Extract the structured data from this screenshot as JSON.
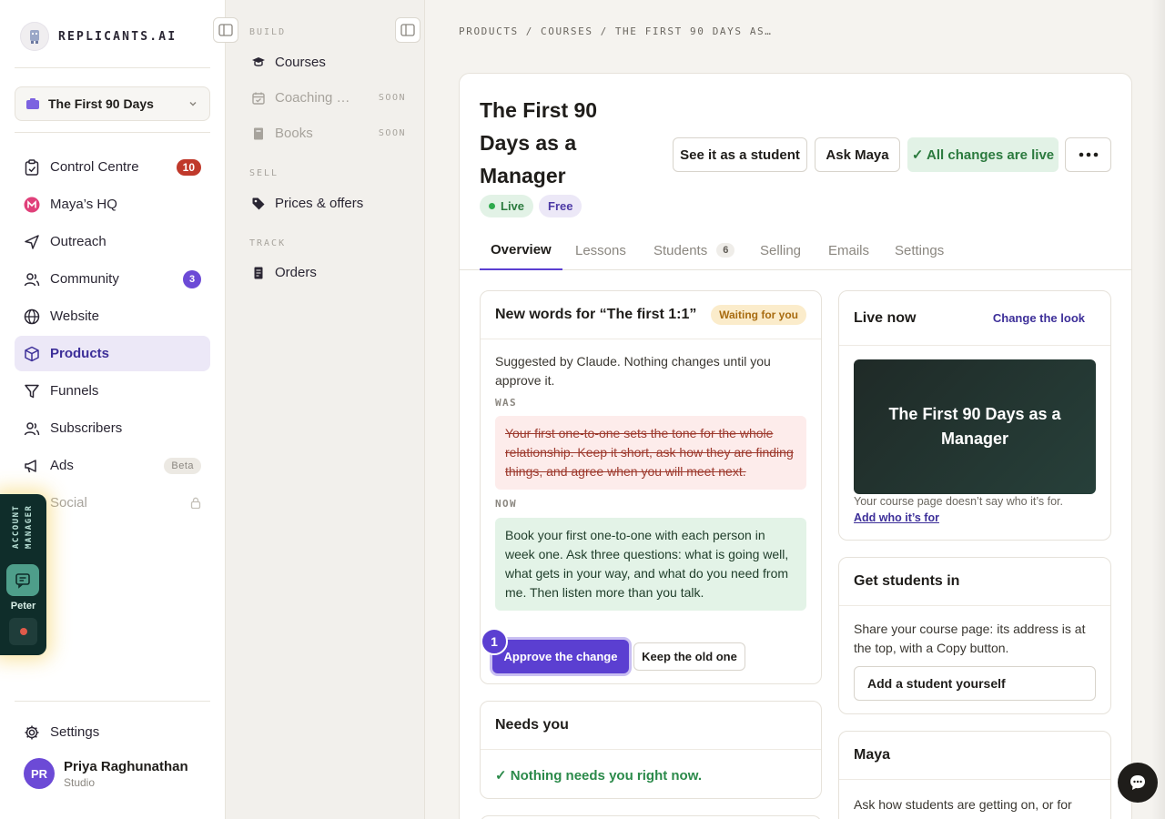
{
  "brand": {
    "name": "REPLICANTS.AI"
  },
  "project": {
    "name": "The First 90 Days"
  },
  "nav": {
    "items": [
      {
        "label": "Control Centre",
        "badge": "10"
      },
      {
        "label": "Maya’s HQ"
      },
      {
        "label": "Outreach"
      },
      {
        "label": "Community",
        "badge": "3"
      },
      {
        "label": "Website"
      },
      {
        "label": "Products"
      },
      {
        "label": "Funnels"
      },
      {
        "label": "Subscribers"
      },
      {
        "label": "Ads",
        "badge": "Beta"
      },
      {
        "label": "Social"
      }
    ],
    "settings": "Settings"
  },
  "user": {
    "initials": "PR",
    "name": "Priya Raghunathan",
    "role": "Studio"
  },
  "account_manager": {
    "label": "ACCOUNT MANAGER",
    "name": "Peter"
  },
  "subnav": {
    "build_head": "BUILD",
    "courses": "Courses",
    "coaching": "Coaching …",
    "coaching_soon": "SOON",
    "books": "Books",
    "books_soon": "SOON",
    "sell_head": "SELL",
    "prices": "Prices & offers",
    "track_head": "TRACK",
    "orders": "Orders"
  },
  "breadcrumb": {
    "a": "PRODUCTS",
    "sep1": "/",
    "b": "COURSES",
    "sep2": "/",
    "c": "THE FIRST 90 DAYS AS…"
  },
  "course": {
    "title": "The First 90 Days as a Manager",
    "status": "Live",
    "price_tag": "Free",
    "see_student": "See it as a student",
    "ask_maya": "Ask Maya",
    "changes_live": "✓ All changes are live"
  },
  "tabs": {
    "overview": "Overview",
    "lessons": "Lessons",
    "students": "Students",
    "students_count": "6",
    "selling": "Selling",
    "emails": "Emails",
    "settings": "Settings"
  },
  "suggestion": {
    "title": "New words for “The first 1:1”",
    "status": "Waiting for you",
    "intro": "Suggested by Claude. Nothing changes until you approve it.",
    "was_label": "WAS",
    "was_text": "Your first one-to-one sets the tone for the whole relationship. Keep it short, ask how they are finding things, and agree when you will meet next.",
    "now_label": "NOW",
    "now_text": "Book your first one-to-one with each person in week one. Ask three questions: what is going well, what gets in your way, and what do you need from me. Then listen more than you talk.",
    "step": "1",
    "approve": "Approve the change",
    "keep": "Keep the old one"
  },
  "needs_you": {
    "title": "Needs you",
    "text": "✓ Nothing needs you right now."
  },
  "live_now": {
    "title": "Live now",
    "change_look": "Change the look",
    "preview_title": "The First 90 Days as a Manager",
    "note": "Your course page doesn’t say who it’s for.",
    "add_link": "Add who it’s for"
  },
  "get_students": {
    "title": "Get students in",
    "text": "Share your course page: its address is at the top, with a Copy button.",
    "add_button": "Add a student yourself"
  },
  "maya": {
    "title": "Maya",
    "text": "Ask how students are getting on, or for"
  },
  "colors": {
    "accent": "#5b3fd1",
    "live_green": "#2b7a3e",
    "badge_red": "#c0392b",
    "waiting": "#a86b10"
  }
}
